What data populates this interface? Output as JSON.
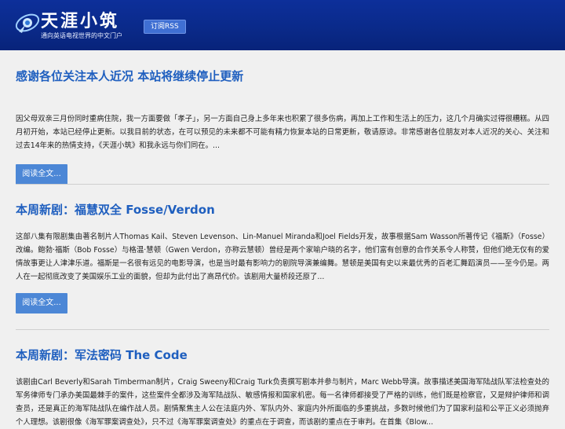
{
  "site": {
    "title": "天涯小筑",
    "subtitle": "通向英语电视世界的中文门户",
    "rss_label": "订阅RSS"
  },
  "posts": [
    {
      "title": "感谢各位关注本人近况 本站将继续停止更新",
      "excerpt": "因父母双亲三月份同时重病住院，我一方面要做「孝子」，另一方面自己身上多年来也积累了很多伤病，再加上工作和生活上的压力，这几个月确实过得很糟糕。从四月初开始，本站已经停止更新。以我目前的状态，在可以预见的未来都不可能有精力恢复本站的日常更新，敬请原谅。非常感谢各位朋友对本人近况的关心、关注和过去14年来的热情支持，《天涯小筑》和我永远与你们同在。...",
      "read_more": "阅读全文..."
    },
    {
      "title": "本周新剧：福慧双全 Fosse/Verdon",
      "excerpt": "这部八集有限剧集由著名制片人Thomas Kail、Steven Levenson、Lin-Manuel Miranda和Joel Fields开发，故事根据Sam Wasson所著传记《福斯》（Fosse）改编。鲍勃·福斯（Bob Fosse）与格温·慧顿（Gwen Verdon，亦称云慧顿）曾经是两个家喻户晓的名字，他们富有创意的合作关系令人称赞，但他们绝无仅有的爱情故事更让人津津乐道。福斯是一名很有远见的电影导演，也是当时最有影响力的剧院导演兼编舞。慧顿是美国有史以来最优秀的百老汇舞蹈演员——至今仍是。两人在一起彻底改变了美国娱乐工业的面貌，但却为此付出了高昂代价。该剧用大量桥段还原了...",
      "read_more": "阅读全文..."
    },
    {
      "title": "本周新剧：军法密码 The Code",
      "excerpt": "该剧由Carl Beverly和Sarah Timberman制片，Craig Sweeny和Craig Turk负责撰写剧本并参与制片，Marc Webb导演。故事描述美国海军陆战队军法检查处的军务律师专门承办美国最棘手的案件，这些案件全都涉及海军陆战队、敏感情报和国家机密。每一名律师都接受了严格的训练，他们既是检察官，又是辩护律师和调查员，还是真正的海军陆战队在编作战人员。剧情聚焦主人公在法庭内外、军队内外、家庭内外所面临的多重挑战，多数时候他们为了国家利益和公平正义必须抛弃个人理想。该剧很像《海军罪案调查处》，只不过《海军罪案调查处》的重点在于调查，而该剧的重点在于审判。在首集《Blow..."
    }
  ]
}
